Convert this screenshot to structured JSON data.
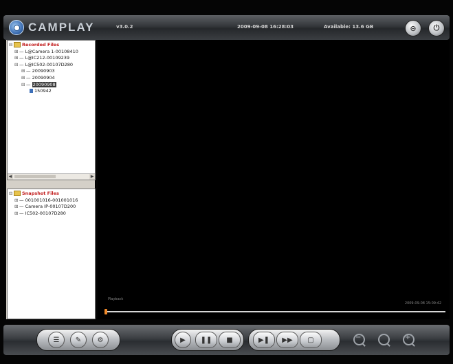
{
  "app": {
    "logo": "CAMPLAY",
    "version": "v3.0.2",
    "datetime": "2009-09-08 16:28:03",
    "available": "Available: 13.6 GB"
  },
  "recorded_files": {
    "root": "Recorded Files",
    "items": [
      "L@Camera 1-00108410",
      "L@IC212-00109239",
      "L@IC502-00107D280",
      "20090903",
      "20090904",
      "20090908",
      "150942"
    ]
  },
  "snapshot_files": {
    "root": "Snapshot Files",
    "items": [
      "001001016-001001016",
      "Camera IP-00107D200",
      "IC502-00107D280"
    ]
  },
  "video": {
    "channel_label": "Playback",
    "timestamp": "2009-09-08 15:09:42"
  },
  "playback": {
    "position_fraction": 0.0
  },
  "icons": {
    "minimize": "minimize-icon",
    "close": "power-close-icon",
    "play": "play-icon",
    "pause": "pause-icon",
    "stop": "stop-icon",
    "step_forward": "step-forward-icon",
    "fast_forward": "fast-forward-icon",
    "snapshot": "snapshot-icon",
    "zoom_out": "zoom-out-icon",
    "zoom_reset": "zoom-reset-icon",
    "zoom_in": "zoom-in-icon"
  },
  "colors": {
    "accent_orange": "#f28a29",
    "tree_root_red": "#c01818"
  }
}
